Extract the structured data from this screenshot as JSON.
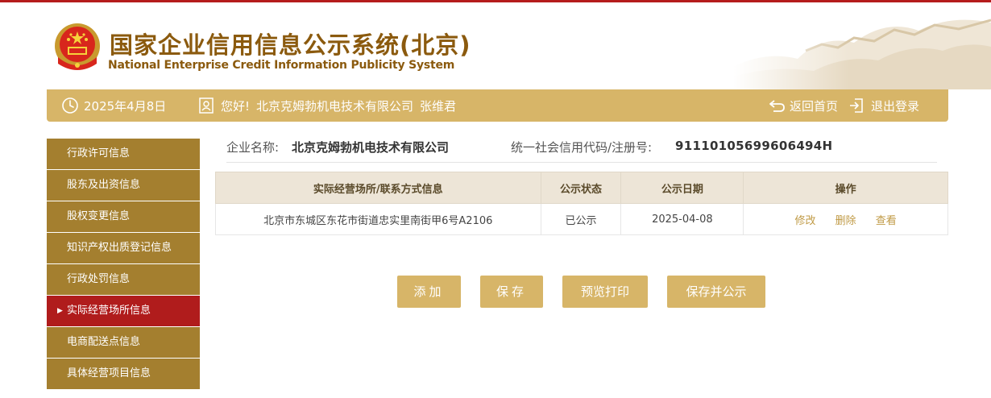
{
  "header": {
    "title_cn": "国家企业信用信息公示系统(北京)",
    "title_en": "National Enterprise Credit Information Publicity System"
  },
  "info_bar": {
    "date": "2025年4月8日",
    "greeting": "您好!",
    "company": "北京克姆勃机电技术有限公司",
    "person": "张维君",
    "home_label": "返回首页",
    "logout_label": "退出登录"
  },
  "sidebar": {
    "items": [
      {
        "label": "行政许可信息",
        "active": false
      },
      {
        "label": "股东及出资信息",
        "active": false
      },
      {
        "label": "股权变更信息",
        "active": false
      },
      {
        "label": "知识产权出质登记信息",
        "active": false
      },
      {
        "label": "行政处罚信息",
        "active": false
      },
      {
        "label": "实际经营场所信息",
        "active": true
      },
      {
        "label": "电商配送点信息",
        "active": false
      },
      {
        "label": "具体经营项目信息",
        "active": false
      }
    ],
    "active_marker": "▶"
  },
  "company_info": {
    "name_label": "企业名称:",
    "name_value": "北京克姆勃机电技术有限公司",
    "code_label": "统一社会信用代码/注册号:",
    "code_value": "91110105699606494H"
  },
  "table": {
    "headers": [
      "实际经营场所/联系方式信息",
      "公示状态",
      "公示日期",
      "操作"
    ],
    "rows": [
      {
        "address": "北京市东城区东花市街道忠实里南街甲6号A2106",
        "status": "已公示",
        "date": "2025-04-08",
        "actions": [
          "修改",
          "删除",
          "查看"
        ]
      }
    ]
  },
  "buttons": {
    "add": "添加",
    "save": "保存",
    "preview": "预览打印",
    "save_publish": "保存并公示"
  },
  "colors": {
    "accent_gold": "#d7b568",
    "sidebar_brown": "#a47f2f",
    "active_red": "#b01c1c",
    "title_brown": "#8b5a0e"
  }
}
